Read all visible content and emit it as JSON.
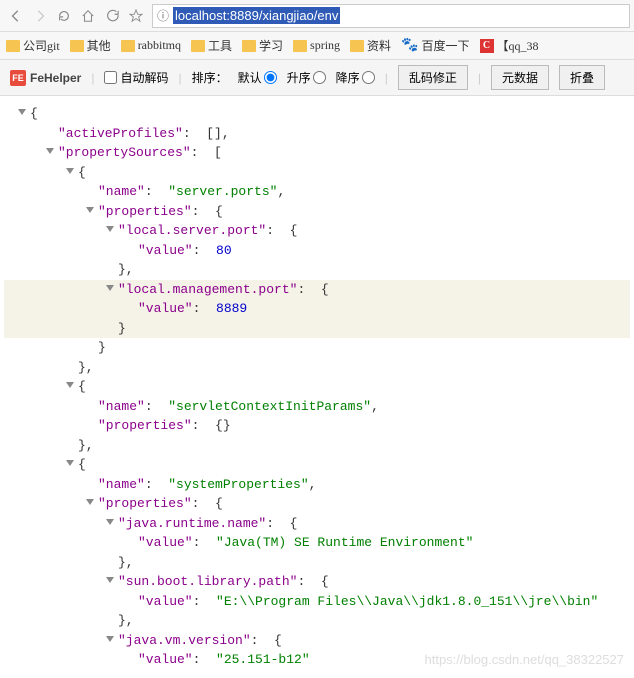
{
  "nav": {
    "url": "localhost:8889/xiangjiao/env"
  },
  "bookmarks": {
    "b0": "公司git",
    "b1": "其他",
    "b2": "rabbitmq",
    "b3": "工具",
    "b4": "学习",
    "b5": "spring",
    "b6": "资料",
    "b7": "百度一下",
    "b8": "【qq_38"
  },
  "toolbar": {
    "name": "FeHelper",
    "autodecode": "自动解码",
    "sort_label": "排序：",
    "sort_default": "默认",
    "sort_asc": "升序",
    "sort_desc": "降序",
    "btn_fix": "乱码修正",
    "btn_raw": "元数据",
    "btn_collapse": "折叠"
  },
  "json": {
    "k_activeProfiles": "\"activeProfiles\"",
    "v_activeProfiles": "[]",
    "k_propertySources": "\"propertySources\"",
    "k_name": "\"name\"",
    "k_properties": "\"properties\"",
    "k_value": "\"value\"",
    "s0_name": "\"server.ports\"",
    "s0_p0_key": "\"local.server.port\"",
    "s0_p0_val": "80",
    "s0_p1_key": "\"local.management.port\"",
    "s0_p1_val": "8889",
    "s1_name": "\"servletContextInitParams\"",
    "s2_name": "\"systemProperties\"",
    "s2_p0_key": "\"java.runtime.name\"",
    "s2_p0_val": "\"Java(TM) SE Runtime Environment\"",
    "s2_p1_key": "\"sun.boot.library.path\"",
    "s2_p1_val": "\"E:\\\\Program Files\\\\Java\\\\jdk1.8.0_151\\\\jre\\\\bin\"",
    "s2_p2_key": "\"java.vm.version\"",
    "s2_p2_val": "\"25.151-b12\""
  },
  "watermark": "https://blog.csdn.net/qq_38322527"
}
